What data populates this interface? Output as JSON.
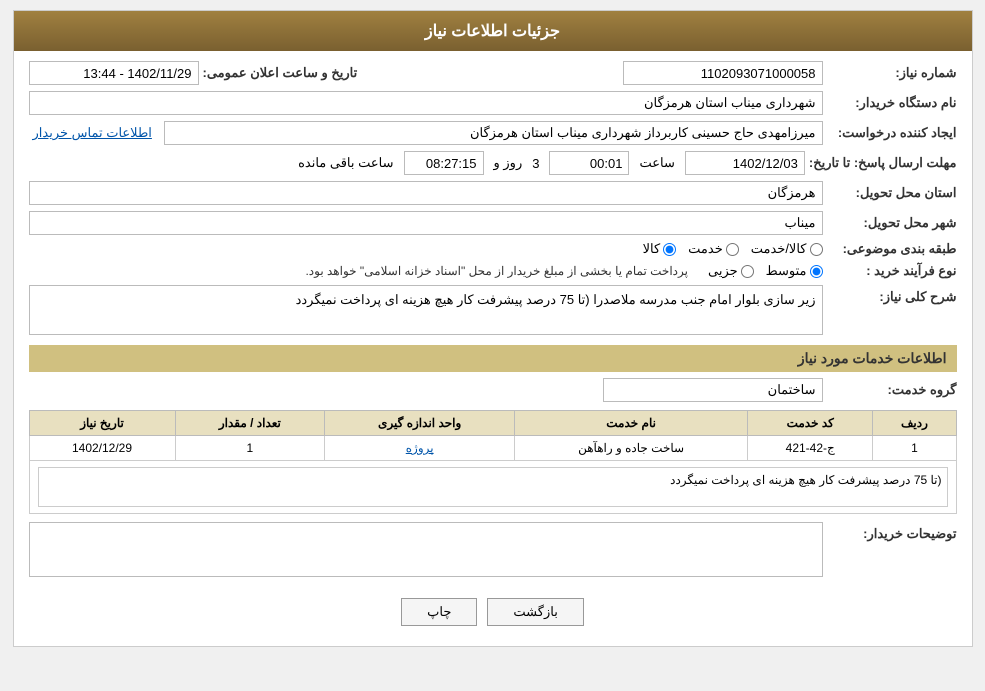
{
  "header": {
    "title": "جزئیات اطلاعات نیاز"
  },
  "fields": {
    "need_number_label": "شماره نیاز:",
    "need_number_value": "1102093071000058",
    "buyer_org_label": "نام دستگاه خریدار:",
    "buyer_org_value": "شهرداری میناب استان هرمزگان",
    "announcement_datetime_label": "تاریخ و ساعت اعلان عمومی:",
    "announcement_datetime_value": "1402/11/29 - 13:44",
    "creator_label": "ایجاد کننده درخواست:",
    "creator_value": "میرزامهدی حاج حسینی کاربرداز شهرداری میناب استان هرمزگان",
    "contact_link": "اطلاعات تماس خریدار",
    "response_deadline_label": "مهلت ارسال پاسخ: تا تاریخ:",
    "response_date_value": "1402/12/03",
    "response_time_label": "ساعت",
    "response_time_value": "00:01",
    "response_days_value": "3",
    "response_days_label": "روز و",
    "remaining_time_value": "08:27:15",
    "remaining_time_label": "ساعت باقی مانده",
    "delivery_province_label": "استان محل تحویل:",
    "delivery_province_value": "هرمزگان",
    "delivery_city_label": "شهر محل تحویل:",
    "delivery_city_value": "میناب",
    "category_label": "طبقه بندی موضوعی:",
    "category_options": [
      "کالا",
      "خدمت",
      "کالا/خدمت"
    ],
    "category_selected": "کالا",
    "purchase_type_label": "نوع فرآیند خرید :",
    "purchase_type_options": [
      "جزیی",
      "متوسط"
    ],
    "purchase_type_note": "پرداخت تمام یا بخشی از مبلغ خریدار از محل \"اسناد خزانه اسلامی\" خواهد بود.",
    "purchase_type_selected": "متوسط",
    "need_description_label": "شرح کلی نیاز:",
    "need_description_value": "زیر سازی بلوار امام جنب مدرسه ملاصدرا (تا 75 درصد پیشرفت کار هیچ هزینه ای پرداخت نمیگردد",
    "services_section_title": "اطلاعات خدمات مورد نیاز",
    "service_group_label": "گروه خدمت:",
    "service_group_value": "ساختمان",
    "table": {
      "headers": [
        "ردیف",
        "کد خدمت",
        "نام خدمت",
        "واحد اندازه گیری",
        "تعداد / مقدار",
        "تاریخ نیاز"
      ],
      "rows": [
        {
          "row_num": "1",
          "service_code": "ج-42-421",
          "service_name": "ساخت جاده و راهآهن",
          "unit": "پروژه",
          "quantity": "1",
          "need_date": "1402/12/29"
        }
      ]
    },
    "row_note": "(تا 75 درصد پیشرفت کار هیچ هزینه ای پرداخت نمیگردد",
    "buyer_description_label": "توضیحات خریدار:",
    "buyer_description_value": ""
  },
  "buttons": {
    "print_label": "چاپ",
    "back_label": "بازگشت"
  }
}
